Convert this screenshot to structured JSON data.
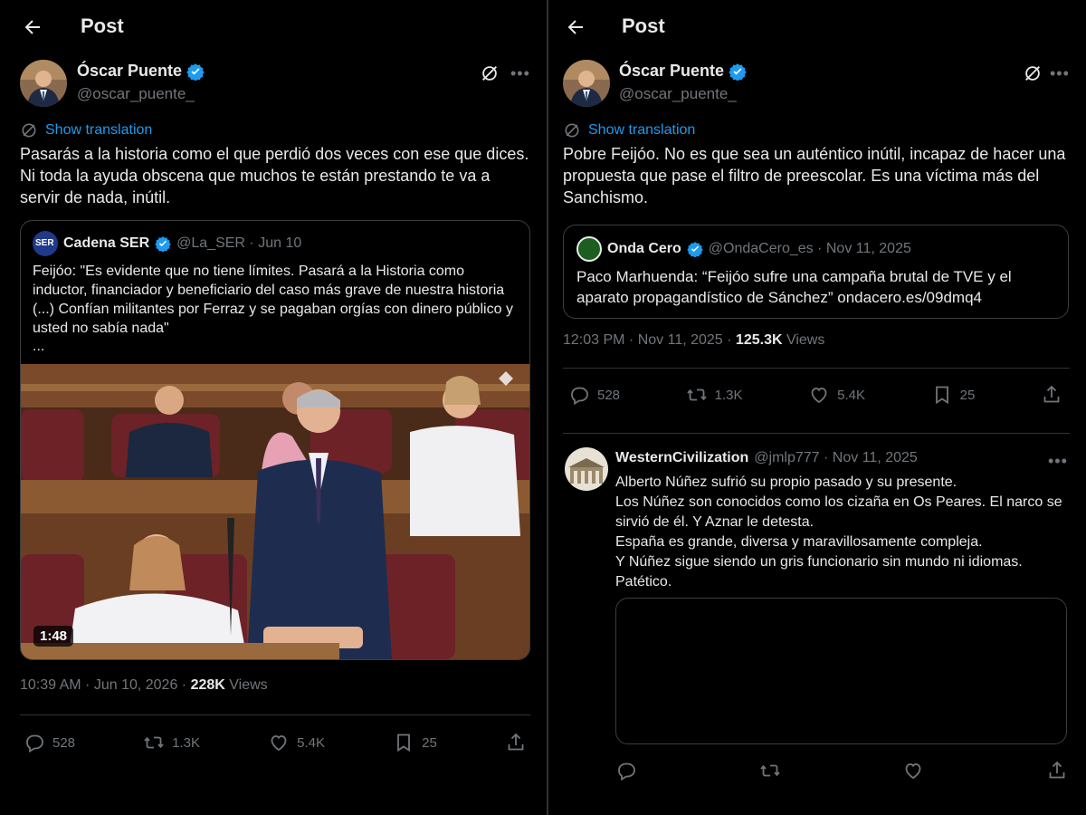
{
  "left": {
    "header_title": "Post",
    "author": {
      "name": "Óscar Puente",
      "handle": "@oscar_puente_"
    },
    "translate_label": "Show translation",
    "text": "Pasarás a la historia como el que perdió dos veces con ese que dices. Ni toda la ayuda obscena que muchos te están prestando te va a servir de nada, inútil.",
    "quote": {
      "logo_text": "SER",
      "name": "Cadena SER",
      "handle": "@La_SER · Jun 10",
      "text": "Feijóo: \"Es evidente que no tiene límites. Pasará a la Historia como inductor, financiador y beneficiario del caso más grave de nuestra historia (...) Confían militantes por Ferraz y se pagaban orgías con dinero público y usted no sabía nada\"",
      "more": "...",
      "video_duration": "1:48"
    },
    "timestamp": "10:39 AM · Jun 10, 2026 ·",
    "views_count": "228K",
    "views_label": "Views",
    "stats": {
      "replies": "528",
      "reposts": "1.3K",
      "likes": "5.4K",
      "bookmarks": "25"
    }
  },
  "right": {
    "header_title": "Post",
    "author": {
      "name": "Óscar Puente",
      "handle": "@oscar_puente_"
    },
    "translate_label": "Show translation",
    "text": "Pobre Feijóo. No es que sea un auténtico inútil, incapaz de hacer una propuesta que pase el filtro de preescolar. Es una víctima más del Sanchismo.",
    "quote": {
      "name": "Onda Cero",
      "handle": "@OndaCero_es · Nov 11, 2025",
      "text": "Paco Marhuenda: “Feijóo sufre una campaña brutal de TVE y el aparato propagandístico de Sánchez” ondacero.es/09dmq4"
    },
    "timestamp": "12:03 PM · Nov 11, 2025 ·",
    "views_count": "125.3K",
    "views_label": "Views",
    "stats": {
      "replies": "528",
      "reposts": "1.3K",
      "likes": "5.4K",
      "bookmarks": "25"
    },
    "reply": {
      "name": "WesternCivilization",
      "handle": "@jmlp777 · Nov 11, 2025",
      "lines": [
        "Alberto Núñez sufrió su propio pasado y su presente.",
        "Los Núñez son conocidos como los cizaña en Os Peares. El narco se sirvió de él. Y Aznar le detesta.",
        "España es grande, diversa y maravillosamente compleja.",
        "Y Núñez sigue siendo un gris funcionario sin mundo ni idiomas.",
        "Patético."
      ]
    }
  },
  "colors": {
    "background": "#000000",
    "accent": "#1d9bf0",
    "muted": "#71767b",
    "text": "#e7e9ea",
    "border": "#2f3336"
  },
  "icons": [
    "back-arrow-icon",
    "verified-badge-icon",
    "grok-icon",
    "more-icon",
    "translate-icon",
    "reply-icon",
    "repost-icon",
    "like-icon",
    "bookmark-icon",
    "share-icon"
  ]
}
